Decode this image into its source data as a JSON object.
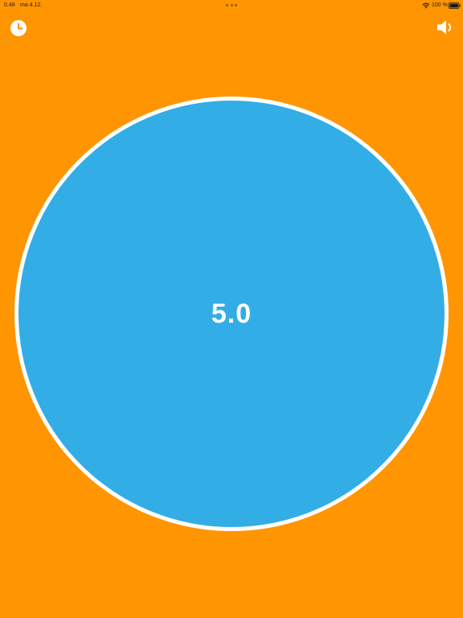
{
  "status_bar": {
    "time": "0.48",
    "date": "ma 4.12.",
    "battery_percent": "100 %",
    "battery_level": 1.0
  },
  "toolbar": {
    "history_icon": "clock-icon",
    "sound_icon": "speaker-icon"
  },
  "timer": {
    "value": "5.0"
  },
  "colors": {
    "background": "#ff9500",
    "circle_fill": "#33ade6",
    "circle_border": "#ffffff",
    "text": "#ffffff"
  }
}
